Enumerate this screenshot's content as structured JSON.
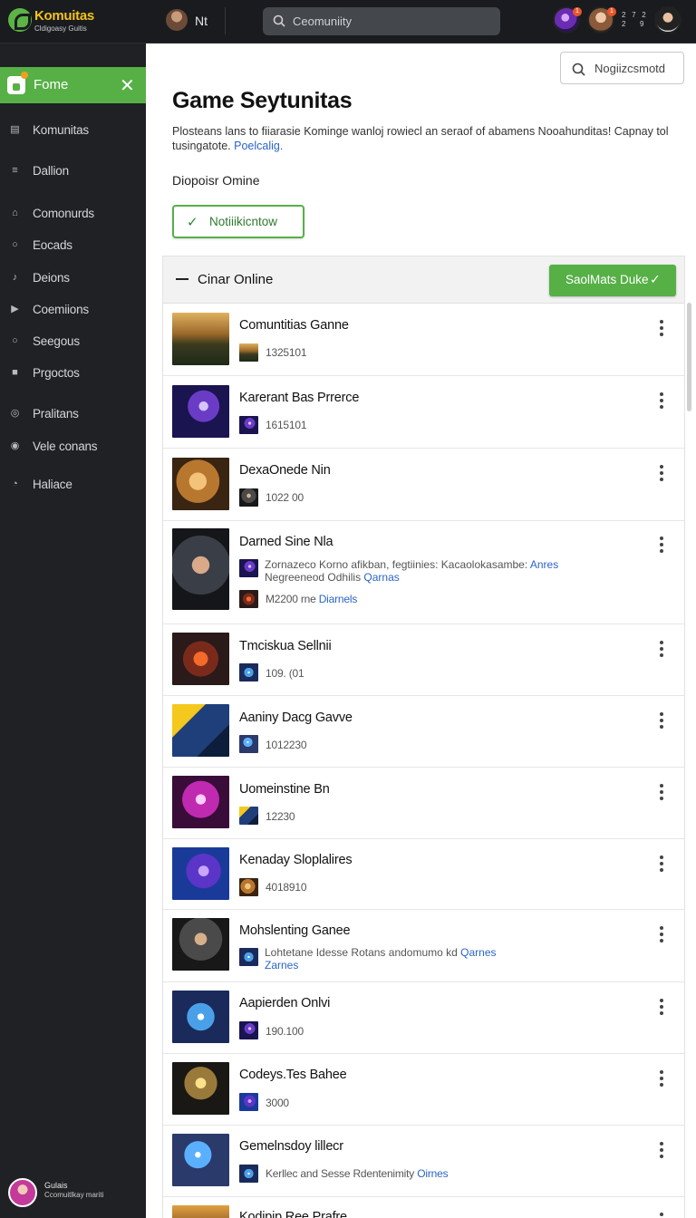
{
  "brand": {
    "title": "Komuitas",
    "subtitle": "Cldigoasy Guitis"
  },
  "topbar": {
    "user_name": "Nt",
    "search_placeholder": "Ceomuniity",
    "avatar_badge_1": "1",
    "avatar_badge_2": "1",
    "small_label_line1": "2   7   2",
    "small_label_line2": "2       9"
  },
  "sidebar": {
    "home_label": "Fome",
    "items": [
      {
        "label": "Komunitas",
        "icon": "document-icon"
      },
      {
        "label": "Dallion",
        "icon": "list-icon"
      },
      {
        "label": "Comonurds",
        "icon": "bag-icon"
      },
      {
        "label": "Eocads",
        "icon": "chat-icon"
      },
      {
        "label": "Deions",
        "icon": "music-icon"
      },
      {
        "label": "Coemiions",
        "icon": "play-icon"
      },
      {
        "label": "Seegous",
        "icon": "search-icon"
      },
      {
        "label": "Prgoctos",
        "icon": "grid-icon"
      },
      {
        "label": "Pralitans",
        "icon": "target-icon"
      },
      {
        "label": "Vele conans",
        "icon": "radio-icon"
      },
      {
        "label": "Haliace",
        "icon": "circle-arrow-icon"
      }
    ],
    "footer": {
      "name": "Gulais",
      "subtitle": "Ccomuitlkay mariti"
    }
  },
  "main": {
    "suggest_button": "Nogiizcsmotd",
    "title": "Game Seytunitas",
    "description": "Plosteans lans to fiiarasie Kominge wanloj rowiecl an seraof of abamens Nooahunditas! Capnay tol tusingatote.",
    "description_link": "Poelcalig.",
    "subheading": "Diopoisr Omine",
    "notify_button": "Notiiikicntow",
    "list": {
      "header_label": "Cinar Online",
      "header_button": "SaolMats Duke",
      "rows": [
        {
          "title": "Comuntitias Ganne",
          "meta": "1325101"
        },
        {
          "title": "Karerant Bas Prrerce",
          "meta": "1615101"
        },
        {
          "title": "DexaOnede Nin",
          "meta": "1022 00"
        },
        {
          "title": "Darned Sine Nla",
          "meta_line1": "Zornazeco Korno afikban, fegtiinies: Kacaolokasambe: ",
          "meta_line1_link": "Anres",
          "meta_line2": "Negreeneod Odhilis ",
          "meta_line2_link": "Qarnas",
          "meta_b": "M2200 rne ",
          "meta_b_link": "Diarnels"
        },
        {
          "title": "Tmciskua Sellnii",
          "meta": "109. (01"
        },
        {
          "title": "Aaniny Dacg Gavve",
          "meta": "1012230"
        },
        {
          "title": "Uomeinstine Bn",
          "meta": "12230"
        },
        {
          "title": "Kenaday Sloplalires",
          "meta": "4018910"
        },
        {
          "title": "Mohslenting Ganee",
          "meta_line1": "Lohtetane Idesse Rotans andomumo kd ",
          "meta_line1_link": "Qarnes",
          "meta_line2": "",
          "meta_line2_link": "Zarnes"
        },
        {
          "title": "Aapierden Onlvi",
          "meta": "190.100"
        },
        {
          "title": "Codeys.Tes Bahee",
          "meta": "3000"
        },
        {
          "title": "Gemelnsdoy lillecr",
          "meta": "Kerllec and Sesse Rdentenimity ",
          "meta_link": "Oirnes"
        },
        {
          "title": "Kodipip Ree Prafre",
          "meta": ""
        }
      ]
    }
  }
}
